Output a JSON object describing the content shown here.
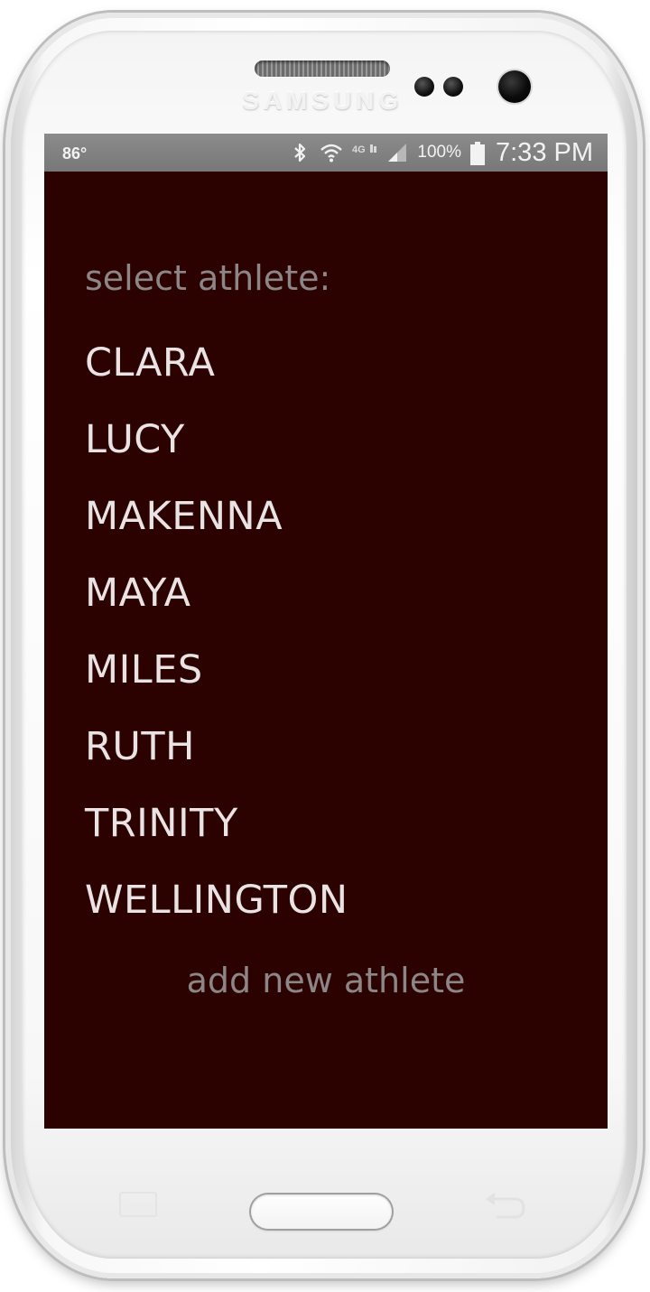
{
  "device": {
    "brand": "SAMSUNG"
  },
  "status_bar": {
    "temperature": "86°",
    "network": "4G",
    "battery_percent": "100%",
    "time": "7:33 PM"
  },
  "screen": {
    "background_color": "#2c0201",
    "prompt": "select athlete:",
    "athletes": [
      "CLARA",
      "LUCY",
      "MAKENNA",
      "MAYA",
      "MILES",
      "RUTH",
      "TRINITY",
      "WELLINGTON"
    ],
    "add_new_label": "add new athlete"
  },
  "icons": {
    "status": [
      "bluetooth-icon",
      "wifi-icon",
      "lte-icon",
      "signal-icon",
      "battery-icon"
    ],
    "hardware": [
      "menu-key-icon",
      "home-button",
      "back-key-icon"
    ]
  }
}
